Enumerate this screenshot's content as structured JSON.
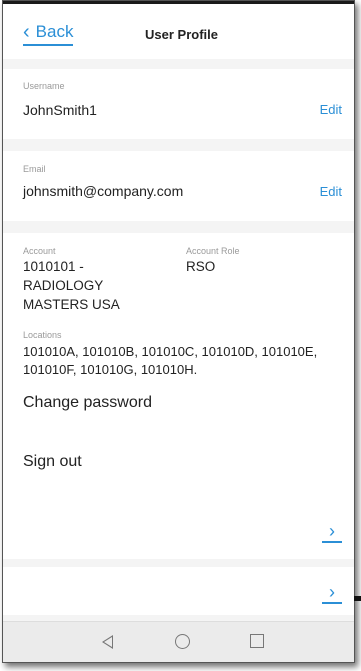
{
  "header": {
    "back_label": "Back",
    "title": "User Profile"
  },
  "username": {
    "label": "Username",
    "value": "JohnSmith1",
    "edit_label": "Edit"
  },
  "email": {
    "label": "Email",
    "value": "johnsmith@company.com",
    "edit_label": "Edit"
  },
  "account": {
    "label": "Account",
    "value": "1010101 - RADIOLOGY MASTERS USA",
    "role_label": "Account Role",
    "role_value": "RSO",
    "locations_label": "Locations",
    "locations_value": "101010A, 101010B, 101010C, 101010D, 101010E, 101010F, 101010G, 101010H."
  },
  "actions": {
    "change_password": "Change password",
    "sign_out": "Sign out"
  },
  "icons": {
    "back": "chevron-left-icon",
    "link": "chevron-right-icon",
    "nav_back": "triangle-back-icon",
    "nav_home": "circle-home-icon",
    "nav_recent": "square-recent-icon"
  },
  "colors": {
    "accent": "#2b8fd6",
    "background": "#f4f4f4",
    "card": "#ffffff"
  }
}
